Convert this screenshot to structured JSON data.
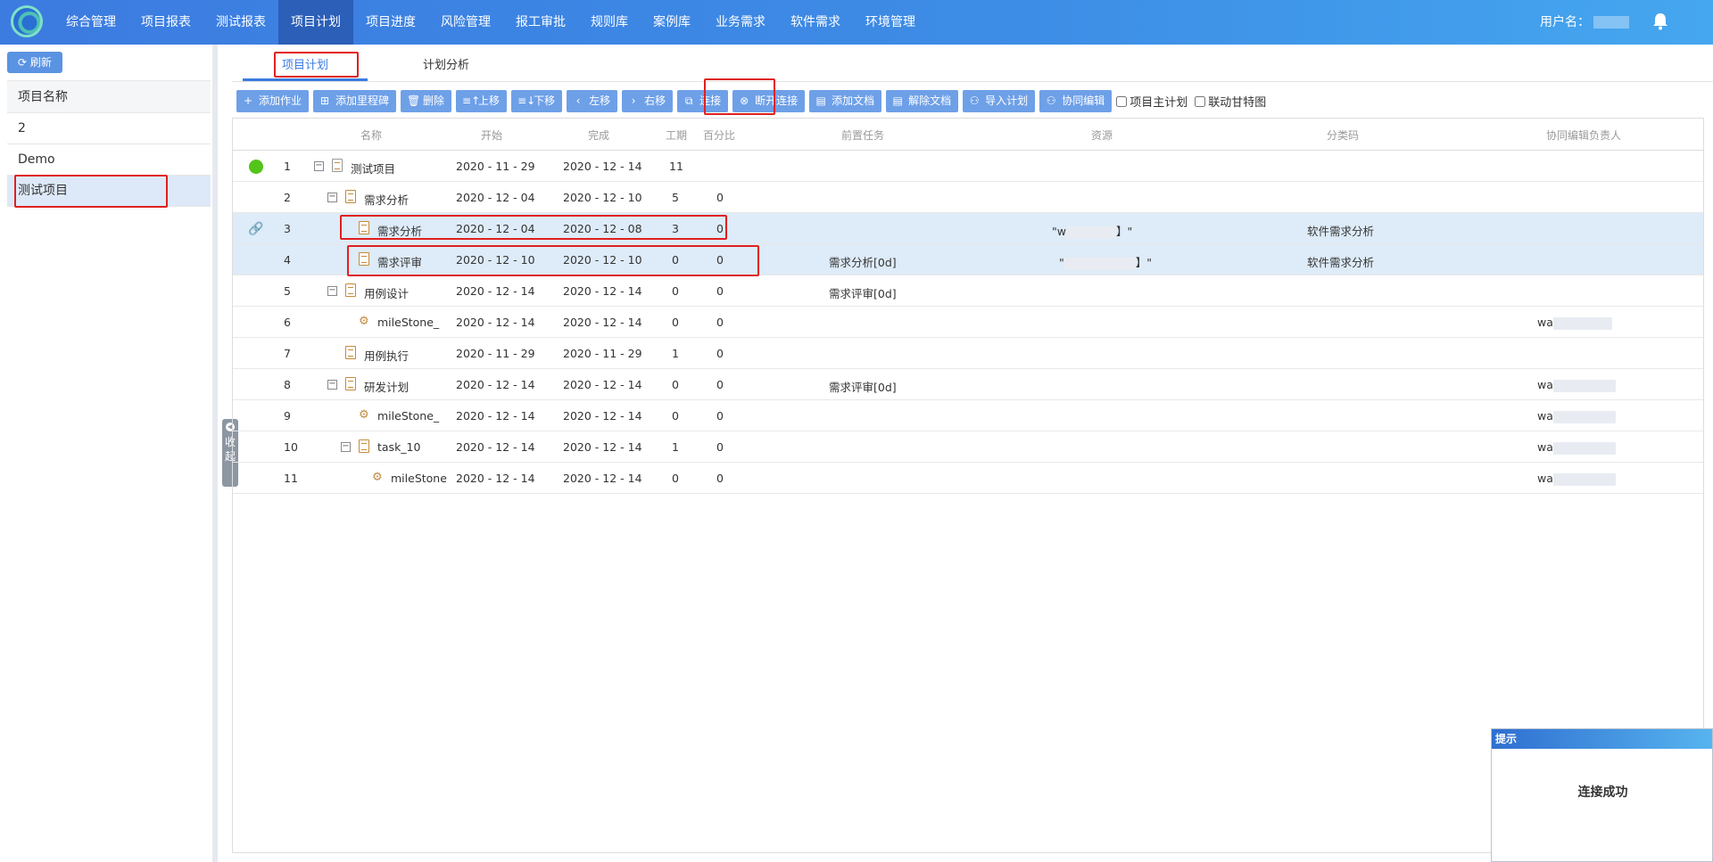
{
  "nav": {
    "items": [
      "综合管理",
      "项目报表",
      "测试报表",
      "项目计划",
      "项目进度",
      "风险管理",
      "报工审批",
      "规则库",
      "案例库",
      "业务需求",
      "软件需求",
      "环境管理"
    ],
    "active_index": 3,
    "user_label": "用户名："
  },
  "left": {
    "refresh_label": "刷新",
    "header": "项目名称",
    "projects": [
      "2",
      "Demo",
      "测试项目"
    ],
    "selected_index": 2,
    "collapse_label_1": "收",
    "collapse_label_2": "起"
  },
  "tabs": {
    "plan": "项目计划",
    "analysis": "计划分析"
  },
  "toolbar": {
    "add_job": "添加作业",
    "add_milestone": "添加里程碑",
    "delete": "删除",
    "move_up": "上移",
    "move_down": "下移",
    "move_left": "左移",
    "move_right": "右移",
    "connect": "连接",
    "disconnect": "断开连接",
    "add_doc": "添加文档",
    "remove_doc": "解除文档",
    "import_plan": "导入计划",
    "co_edit": "协同编辑",
    "master_plan": "项目主计划",
    "linked_gantt": "联动甘特图"
  },
  "grid": {
    "headers": {
      "name": "名称",
      "start": "开始",
      "finish": "完成",
      "duration": "工期",
      "percent": "百分比",
      "predecessor": "前置任务",
      "resource": "资源",
      "category": "分类码",
      "co_editor": "协同编辑负责人"
    },
    "rows": [
      {
        "id": "1",
        "name": "测试项目",
        "start": "2020 - 11 - 29",
        "finish": "2020 - 12 - 14",
        "duration": "11",
        "percent": "",
        "pred": "",
        "res_a": "",
        "res_b": "",
        "cat": "",
        "co": ""
      },
      {
        "id": "2",
        "name": "需求分析",
        "start": "2020 - 12 - 04",
        "finish": "2020 - 12 - 10",
        "duration": "5",
        "percent": "0",
        "pred": "",
        "res_a": "",
        "res_b": "",
        "cat": "",
        "co": ""
      },
      {
        "id": "3",
        "name": "需求分析",
        "start": "2020 - 12 - 04",
        "finish": "2020 - 12 - 08",
        "duration": "3",
        "percent": "0",
        "pred": "",
        "res_a": "\"w",
        "res_b": "】\"",
        "cat": "软件需求分析",
        "co": ""
      },
      {
        "id": "4",
        "name": "需求评审",
        "start": "2020 - 12 - 10",
        "finish": "2020 - 12 - 10",
        "duration": "0",
        "percent": "0",
        "pred": "需求分析[0d]",
        "res_a": "\"",
        "res_b": "】\"",
        "cat": "软件需求分析",
        "co": ""
      },
      {
        "id": "5",
        "name": "用例设计",
        "start": "2020 - 12 - 14",
        "finish": "2020 - 12 - 14",
        "duration": "0",
        "percent": "0",
        "pred": "需求评审[0d]",
        "res_a": "",
        "res_b": "",
        "cat": "",
        "co": ""
      },
      {
        "id": "6",
        "name": "mileStone_",
        "start": "2020 - 12 - 14",
        "finish": "2020 - 12 - 14",
        "duration": "0",
        "percent": "0",
        "pred": "",
        "res_a": "",
        "res_b": "",
        "cat": "",
        "co": "wa"
      },
      {
        "id": "7",
        "name": "用例执行",
        "start": "2020 - 11 - 29",
        "finish": "2020 - 11 - 29",
        "duration": "1",
        "percent": "0",
        "pred": "",
        "res_a": "",
        "res_b": "",
        "cat": "",
        "co": ""
      },
      {
        "id": "8",
        "name": "研发计划",
        "start": "2020 - 12 - 14",
        "finish": "2020 - 12 - 14",
        "duration": "0",
        "percent": "0",
        "pred": "需求评审[0d]",
        "res_a": "",
        "res_b": "",
        "cat": "",
        "co": "wa"
      },
      {
        "id": "9",
        "name": "mileStone_",
        "start": "2020 - 12 - 14",
        "finish": "2020 - 12 - 14",
        "duration": "0",
        "percent": "0",
        "pred": "",
        "res_a": "",
        "res_b": "",
        "cat": "",
        "co": "wa"
      },
      {
        "id": "10",
        "name": "task_10",
        "start": "2020 - 12 - 14",
        "finish": "2020 - 12 - 14",
        "duration": "1",
        "percent": "0",
        "pred": "",
        "res_a": "",
        "res_b": "",
        "cat": "",
        "co": "wa"
      },
      {
        "id": "11",
        "name": "mileStone",
        "start": "2020 - 12 - 14",
        "finish": "2020 - 12 - 14",
        "duration": "0",
        "percent": "0",
        "pred": "",
        "res_a": "",
        "res_b": "",
        "cat": "",
        "co": "wa"
      }
    ]
  },
  "toast": {
    "title": "提示",
    "message": "连接成功"
  },
  "colors": {
    "nav": "#3d8de6",
    "button": "#6ea0e8",
    "highlight_row": "#deebf8",
    "annotation": "#e02020"
  }
}
